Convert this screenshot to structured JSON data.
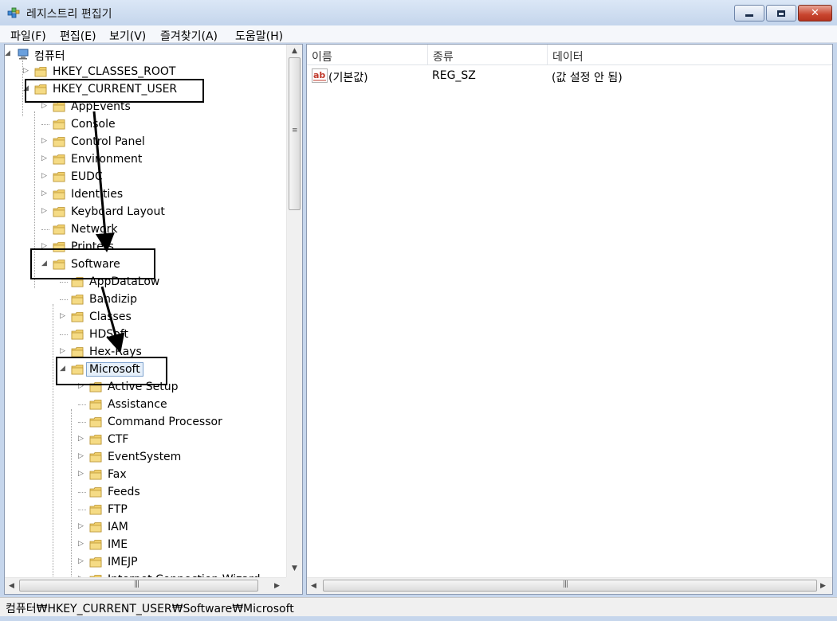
{
  "window": {
    "title": "레지스트리 편집기",
    "buttons": {
      "minimize": "minimize",
      "maximize": "maximize",
      "close": "close"
    }
  },
  "menu": [
    "파일(F)",
    "편집(E)",
    "보기(V)",
    "즐겨찾기(A)",
    "도움말(H)"
  ],
  "tree": {
    "root": "컴퓨터",
    "hkcr": "HKEY_CLASSES_ROOT",
    "hkcu": "HKEY_CURRENT_USER",
    "hkcu_children": [
      "AppEvents",
      "Console",
      "Control Panel",
      "Environment",
      "EUDC",
      "Identities",
      "Keyboard Layout",
      "Network",
      "Printers",
      "Software"
    ],
    "software_children": [
      "AppDataLow",
      "Bandizip",
      "Classes",
      "HDSoft",
      "Hex-Rays",
      "Microsoft"
    ],
    "microsoft_children": [
      "Active Setup",
      "Assistance",
      "Command Processor",
      "CTF",
      "EventSystem",
      "Fax",
      "Feeds",
      "FTP",
      "IAM",
      "IME",
      "IMEJP",
      "Internet Connection Wizard"
    ]
  },
  "list": {
    "columns": [
      "이름",
      "종류",
      "데이터"
    ],
    "rows": [
      {
        "name": "(기본값)",
        "type": "REG_SZ",
        "data": "(값 설정 안 됨)"
      }
    ]
  },
  "status": {
    "path": "컴퓨터₩HKEY_CURRENT_USER₩Software₩Microsoft"
  },
  "colors": {
    "folder": "#e8c45a",
    "annotation": "#000000",
    "selection_border": "#7da2ce"
  }
}
